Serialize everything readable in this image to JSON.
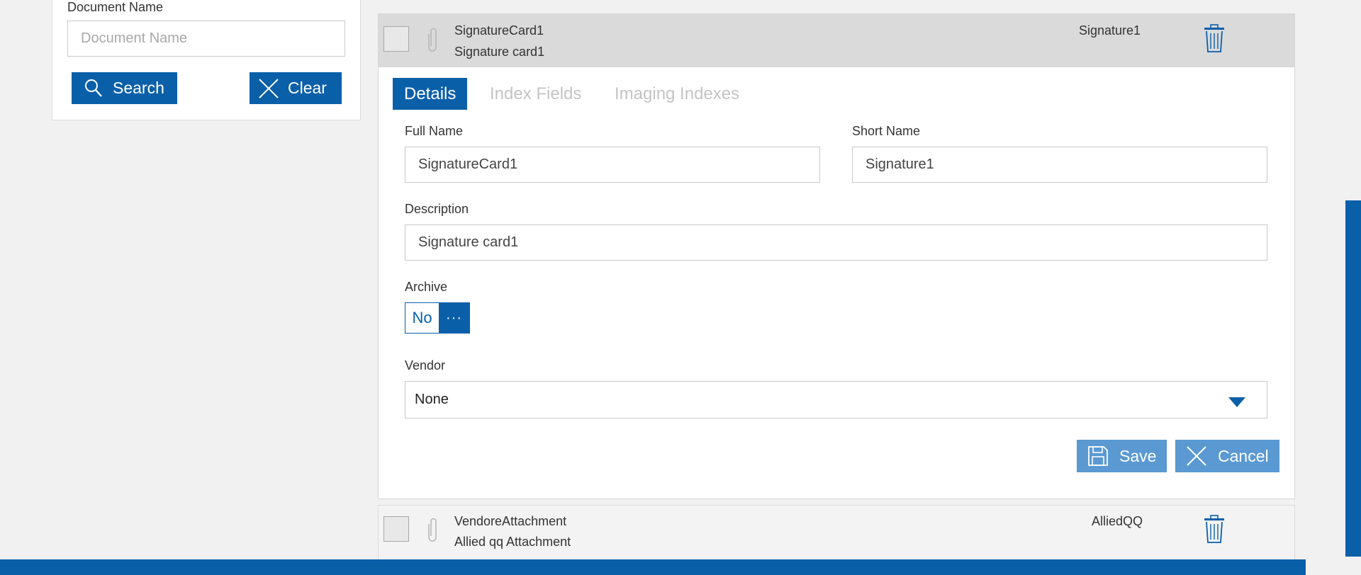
{
  "search": {
    "label": "Document Name",
    "placeholder": "Document Name",
    "search_label": "Search",
    "clear_label": "Clear"
  },
  "documents": [
    {
      "name": "SignatureCard1",
      "description": "Signature card1",
      "short_name": "Signature1",
      "expanded": true
    },
    {
      "name": "VendoreAttachment",
      "description": "Allied qq Attachment",
      "short_name": "AlliedQQ",
      "expanded": false
    }
  ],
  "tabs": [
    {
      "label": "Details",
      "active": true
    },
    {
      "label": "Index Fields",
      "active": false
    },
    {
      "label": "Imaging Indexes",
      "active": false
    }
  ],
  "form": {
    "full_name_label": "Full Name",
    "full_name_value": "SignatureCard1",
    "short_name_label": "Short Name",
    "short_name_value": "Signature1",
    "description_label": "Description",
    "description_value": "Signature card1",
    "archive_label": "Archive",
    "archive_value": "No",
    "archive_button": "···",
    "vendor_label": "Vendor",
    "vendor_value": "None"
  },
  "actions": {
    "save_label": "Save",
    "cancel_label": "Cancel"
  },
  "colors": {
    "primary": "#0a5fa9",
    "primary_light": "#5a99d2",
    "header_gray": "#dadada",
    "background": "#f1f1f1"
  },
  "icons": [
    "search-icon",
    "close-icon",
    "paperclip-icon",
    "trash-icon",
    "save-icon",
    "chevron-down-icon"
  ]
}
